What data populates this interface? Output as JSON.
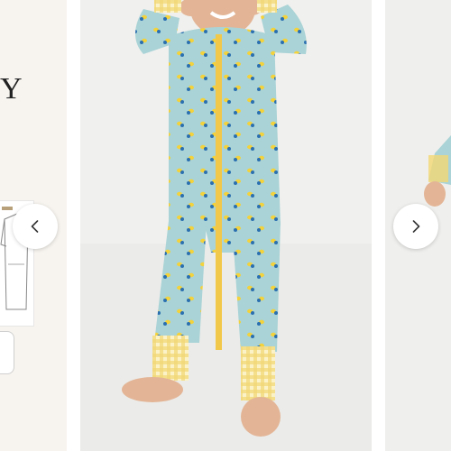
{
  "carousel": {
    "side_text": "Y",
    "prev_icon": "chevron-left-icon",
    "next_icon": "chevron-right-icon"
  },
  "colors": {
    "romper": "#a9d3d6",
    "gingham": "#f2d873",
    "lemon": "#f3d23b",
    "flower": "#2a6fb0",
    "background": "#f0f0ee"
  }
}
